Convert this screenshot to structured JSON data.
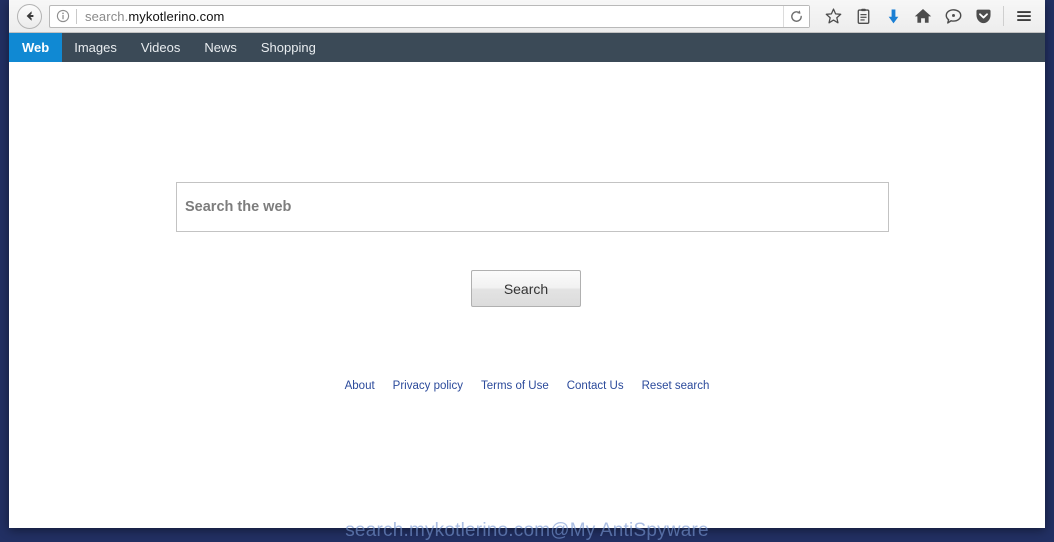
{
  "browser": {
    "back_button": "Back",
    "info_icon": "site-information",
    "url": {
      "prefix": "search.",
      "domain": "mykotlerino.com",
      "full": "search.mykotlerino.com"
    },
    "reload_label": "Reload",
    "toolbar_icons": [
      {
        "name": "bookmark-star-icon",
        "glyph": "star"
      },
      {
        "name": "reader-view-icon",
        "glyph": "clipboard"
      },
      {
        "name": "downloads-icon",
        "glyph": "down-arrow"
      },
      {
        "name": "home-icon",
        "glyph": "house"
      },
      {
        "name": "sync-chat-icon",
        "glyph": "speech-bubble"
      },
      {
        "name": "pocket-icon",
        "glyph": "shield"
      },
      {
        "name": "menu-icon",
        "glyph": "hamburger"
      }
    ]
  },
  "site_nav": {
    "items": [
      {
        "label": "Web",
        "active": true
      },
      {
        "label": "Images",
        "active": false
      },
      {
        "label": "Videos",
        "active": false
      },
      {
        "label": "News",
        "active": false
      },
      {
        "label": "Shopping",
        "active": false
      }
    ]
  },
  "search": {
    "placeholder": "Search the web",
    "value": "",
    "button_label": "Search"
  },
  "footer": {
    "links": [
      "About",
      "Privacy policy",
      "Terms of Use",
      "Contact Us",
      "Reset search"
    ]
  },
  "watermark": {
    "text": "search.mykotlerino.com@My AntiSpyware"
  },
  "colors": {
    "nav_background": "#3b4a57",
    "nav_active": "#1089d3",
    "link": "#2b4a9b",
    "desktop": "#223063",
    "download_arrow": "#1a7fd4"
  }
}
